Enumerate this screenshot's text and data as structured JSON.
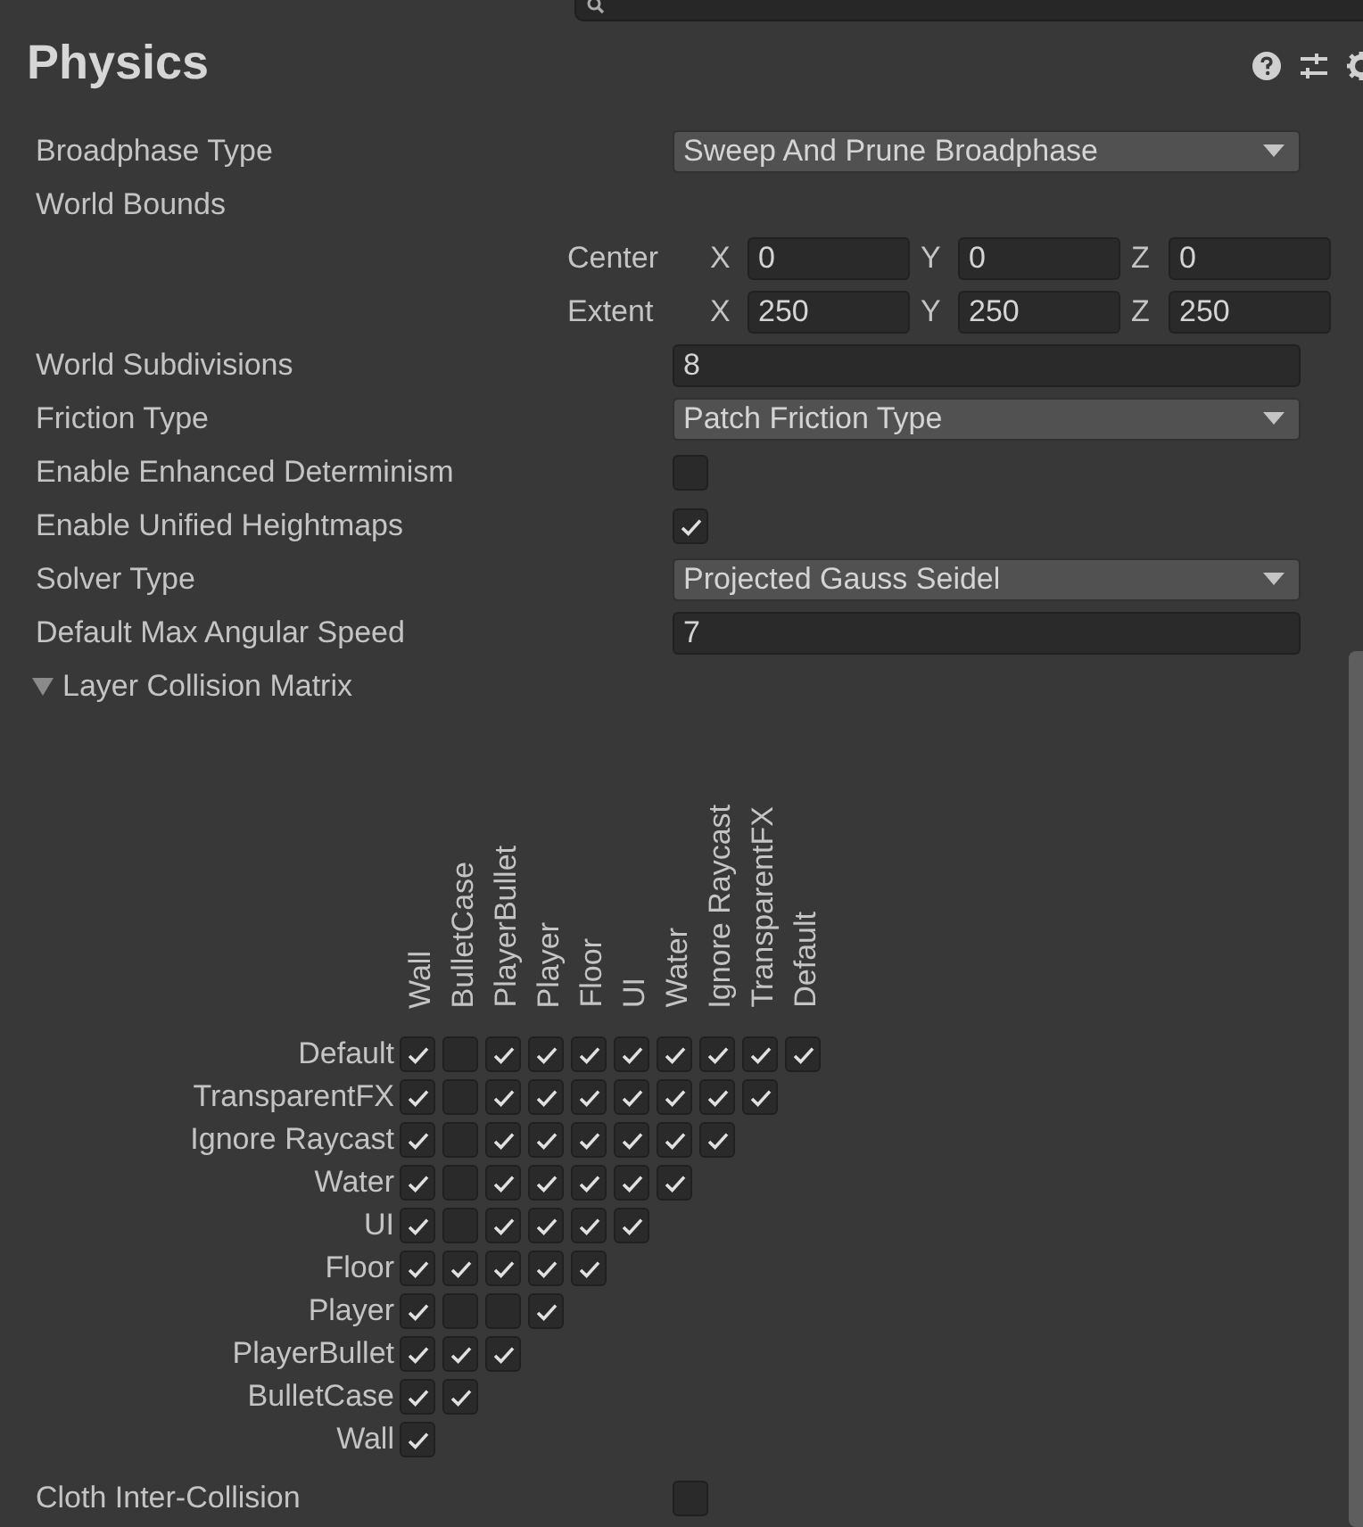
{
  "window": {
    "title": "Physics"
  },
  "properties": [
    {
      "kind": "dropdown",
      "label": "Broadphase Type",
      "value": "Sweep And Prune Broadphase"
    },
    {
      "kind": "heading",
      "label": "World Bounds"
    },
    {
      "kind": "vector",
      "label": "Center",
      "components": [
        {
          "axis": "X",
          "value": "0"
        },
        {
          "axis": "Y",
          "value": "0"
        },
        {
          "axis": "Z",
          "value": "0"
        }
      ]
    },
    {
      "kind": "vector",
      "label": "Extent",
      "components": [
        {
          "axis": "X",
          "value": "250"
        },
        {
          "axis": "Y",
          "value": "250"
        },
        {
          "axis": "Z",
          "value": "250"
        }
      ]
    },
    {
      "kind": "number",
      "label": "World Subdivisions",
      "value": "8"
    },
    {
      "kind": "dropdown",
      "label": "Friction Type",
      "value": "Patch Friction Type"
    },
    {
      "kind": "checkbox",
      "label": "Enable Enhanced Determinism",
      "checked": false
    },
    {
      "kind": "checkbox",
      "label": "Enable Unified Heightmaps",
      "checked": true
    },
    {
      "kind": "dropdown",
      "label": "Solver Type",
      "value": "Projected Gauss Seidel"
    },
    {
      "kind": "number",
      "label": "Default Max Angular Speed",
      "value": "7"
    }
  ],
  "layer_collision_matrix": {
    "label": "Layer Collision Matrix",
    "expanded": true,
    "columns": [
      "Wall",
      "BulletCase",
      "PlayerBullet",
      "Player",
      "Floor",
      "UI",
      "Water",
      "Ignore Raycast",
      "TransparentFX",
      "Default"
    ],
    "rows": [
      {
        "label": "Default",
        "cells": [
          {
            "checked": true
          },
          {
            "checked": false
          },
          {
            "checked": true
          },
          {
            "checked": true
          },
          {
            "checked": true
          },
          {
            "checked": true
          },
          {
            "checked": true
          },
          {
            "checked": true
          },
          {
            "checked": true
          },
          {
            "checked": true
          }
        ]
      },
      {
        "label": "TransparentFX",
        "cells": [
          {
            "checked": true
          },
          {
            "checked": false
          },
          {
            "checked": true
          },
          {
            "checked": true
          },
          {
            "checked": true
          },
          {
            "checked": true
          },
          {
            "checked": true
          },
          {
            "checked": true
          },
          {
            "checked": true
          }
        ]
      },
      {
        "label": "Ignore Raycast",
        "cells": [
          {
            "checked": true
          },
          {
            "checked": false
          },
          {
            "checked": true
          },
          {
            "checked": true
          },
          {
            "checked": true
          },
          {
            "checked": true
          },
          {
            "checked": true
          },
          {
            "checked": true
          }
        ]
      },
      {
        "label": "Water",
        "cells": [
          {
            "checked": true
          },
          {
            "checked": false
          },
          {
            "checked": true
          },
          {
            "checked": true
          },
          {
            "checked": true
          },
          {
            "checked": true
          },
          {
            "checked": true
          }
        ]
      },
      {
        "label": "UI",
        "cells": [
          {
            "checked": true
          },
          {
            "checked": false
          },
          {
            "checked": true
          },
          {
            "checked": true
          },
          {
            "checked": true
          },
          {
            "checked": true
          }
        ]
      },
      {
        "label": "Floor",
        "cells": [
          {
            "checked": true
          },
          {
            "checked": true
          },
          {
            "checked": true
          },
          {
            "checked": true
          },
          {
            "checked": true
          }
        ]
      },
      {
        "label": "Player",
        "cells": [
          {
            "checked": true
          },
          {
            "checked": false
          },
          {
            "checked": false
          },
          {
            "checked": true
          }
        ]
      },
      {
        "label": "PlayerBullet",
        "cells": [
          {
            "checked": true
          },
          {
            "checked": true
          },
          {
            "checked": true
          }
        ]
      },
      {
        "label": "BulletCase",
        "cells": [
          {
            "checked": true
          },
          {
            "checked": true
          }
        ]
      },
      {
        "label": "Wall",
        "cells": [
          {
            "checked": true
          }
        ]
      }
    ]
  },
  "footer_properties": [
    {
      "kind": "checkbox",
      "label": "Cloth Inter-Collision",
      "checked": false
    }
  ]
}
